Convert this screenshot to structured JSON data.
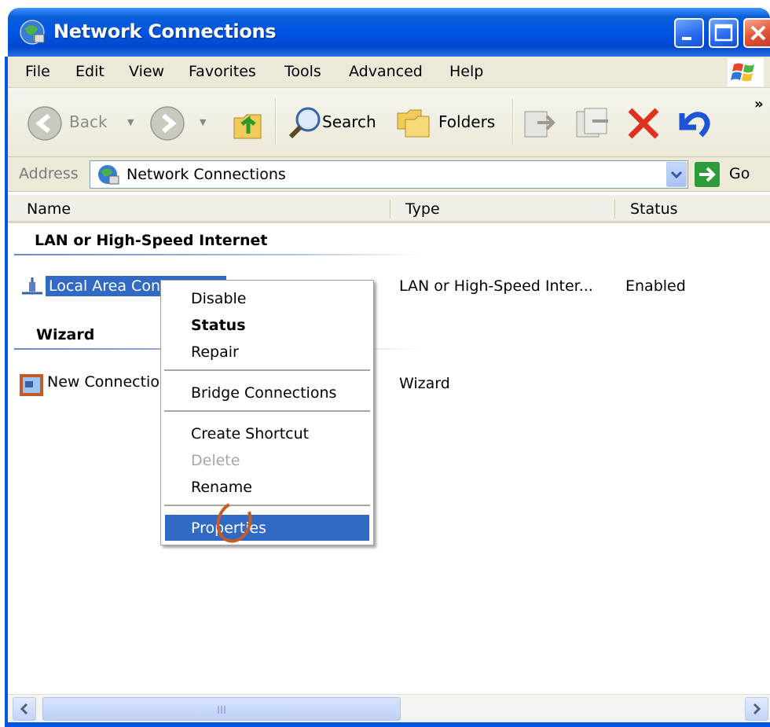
{
  "window": {
    "title": "Network Connections"
  },
  "menubar": {
    "items": [
      "File",
      "Edit",
      "View",
      "Favorites",
      "Tools",
      "Advanced",
      "Help"
    ]
  },
  "toolbar": {
    "back_label": "Back",
    "search_label": "Search",
    "folders_label": "Folders",
    "overflow": "»"
  },
  "address": {
    "label": "Address",
    "value": "Network Connections",
    "go_label": "Go"
  },
  "columns": [
    "Name",
    "Type",
    "Status"
  ],
  "groups": [
    {
      "header": "LAN or High-Speed Internet",
      "items": [
        {
          "name": "Local Area Con",
          "type": "LAN or High-Speed Inter...",
          "status": "Enabled"
        }
      ]
    },
    {
      "header": "Wizard",
      "items": [
        {
          "name": "New Connectio",
          "type": "Wizard",
          "status": ""
        }
      ]
    }
  ],
  "context_menu": {
    "items": [
      {
        "label": "Disable",
        "state": "normal"
      },
      {
        "label": "Status",
        "state": "bold"
      },
      {
        "label": "Repair",
        "state": "normal"
      },
      {
        "label": "Bridge Connections",
        "state": "normal"
      },
      {
        "label": "Create Shortcut",
        "state": "normal"
      },
      {
        "label": "Delete",
        "state": "disabled"
      },
      {
        "label": "Rename",
        "state": "normal"
      },
      {
        "label": "Properties",
        "state": "highlighted"
      }
    ]
  },
  "colors": {
    "titlebar_blue": "#0055e5",
    "selection_blue": "#316ac5",
    "chrome_beige": "#ece9d8",
    "annotation_orange": "#c85a24"
  }
}
